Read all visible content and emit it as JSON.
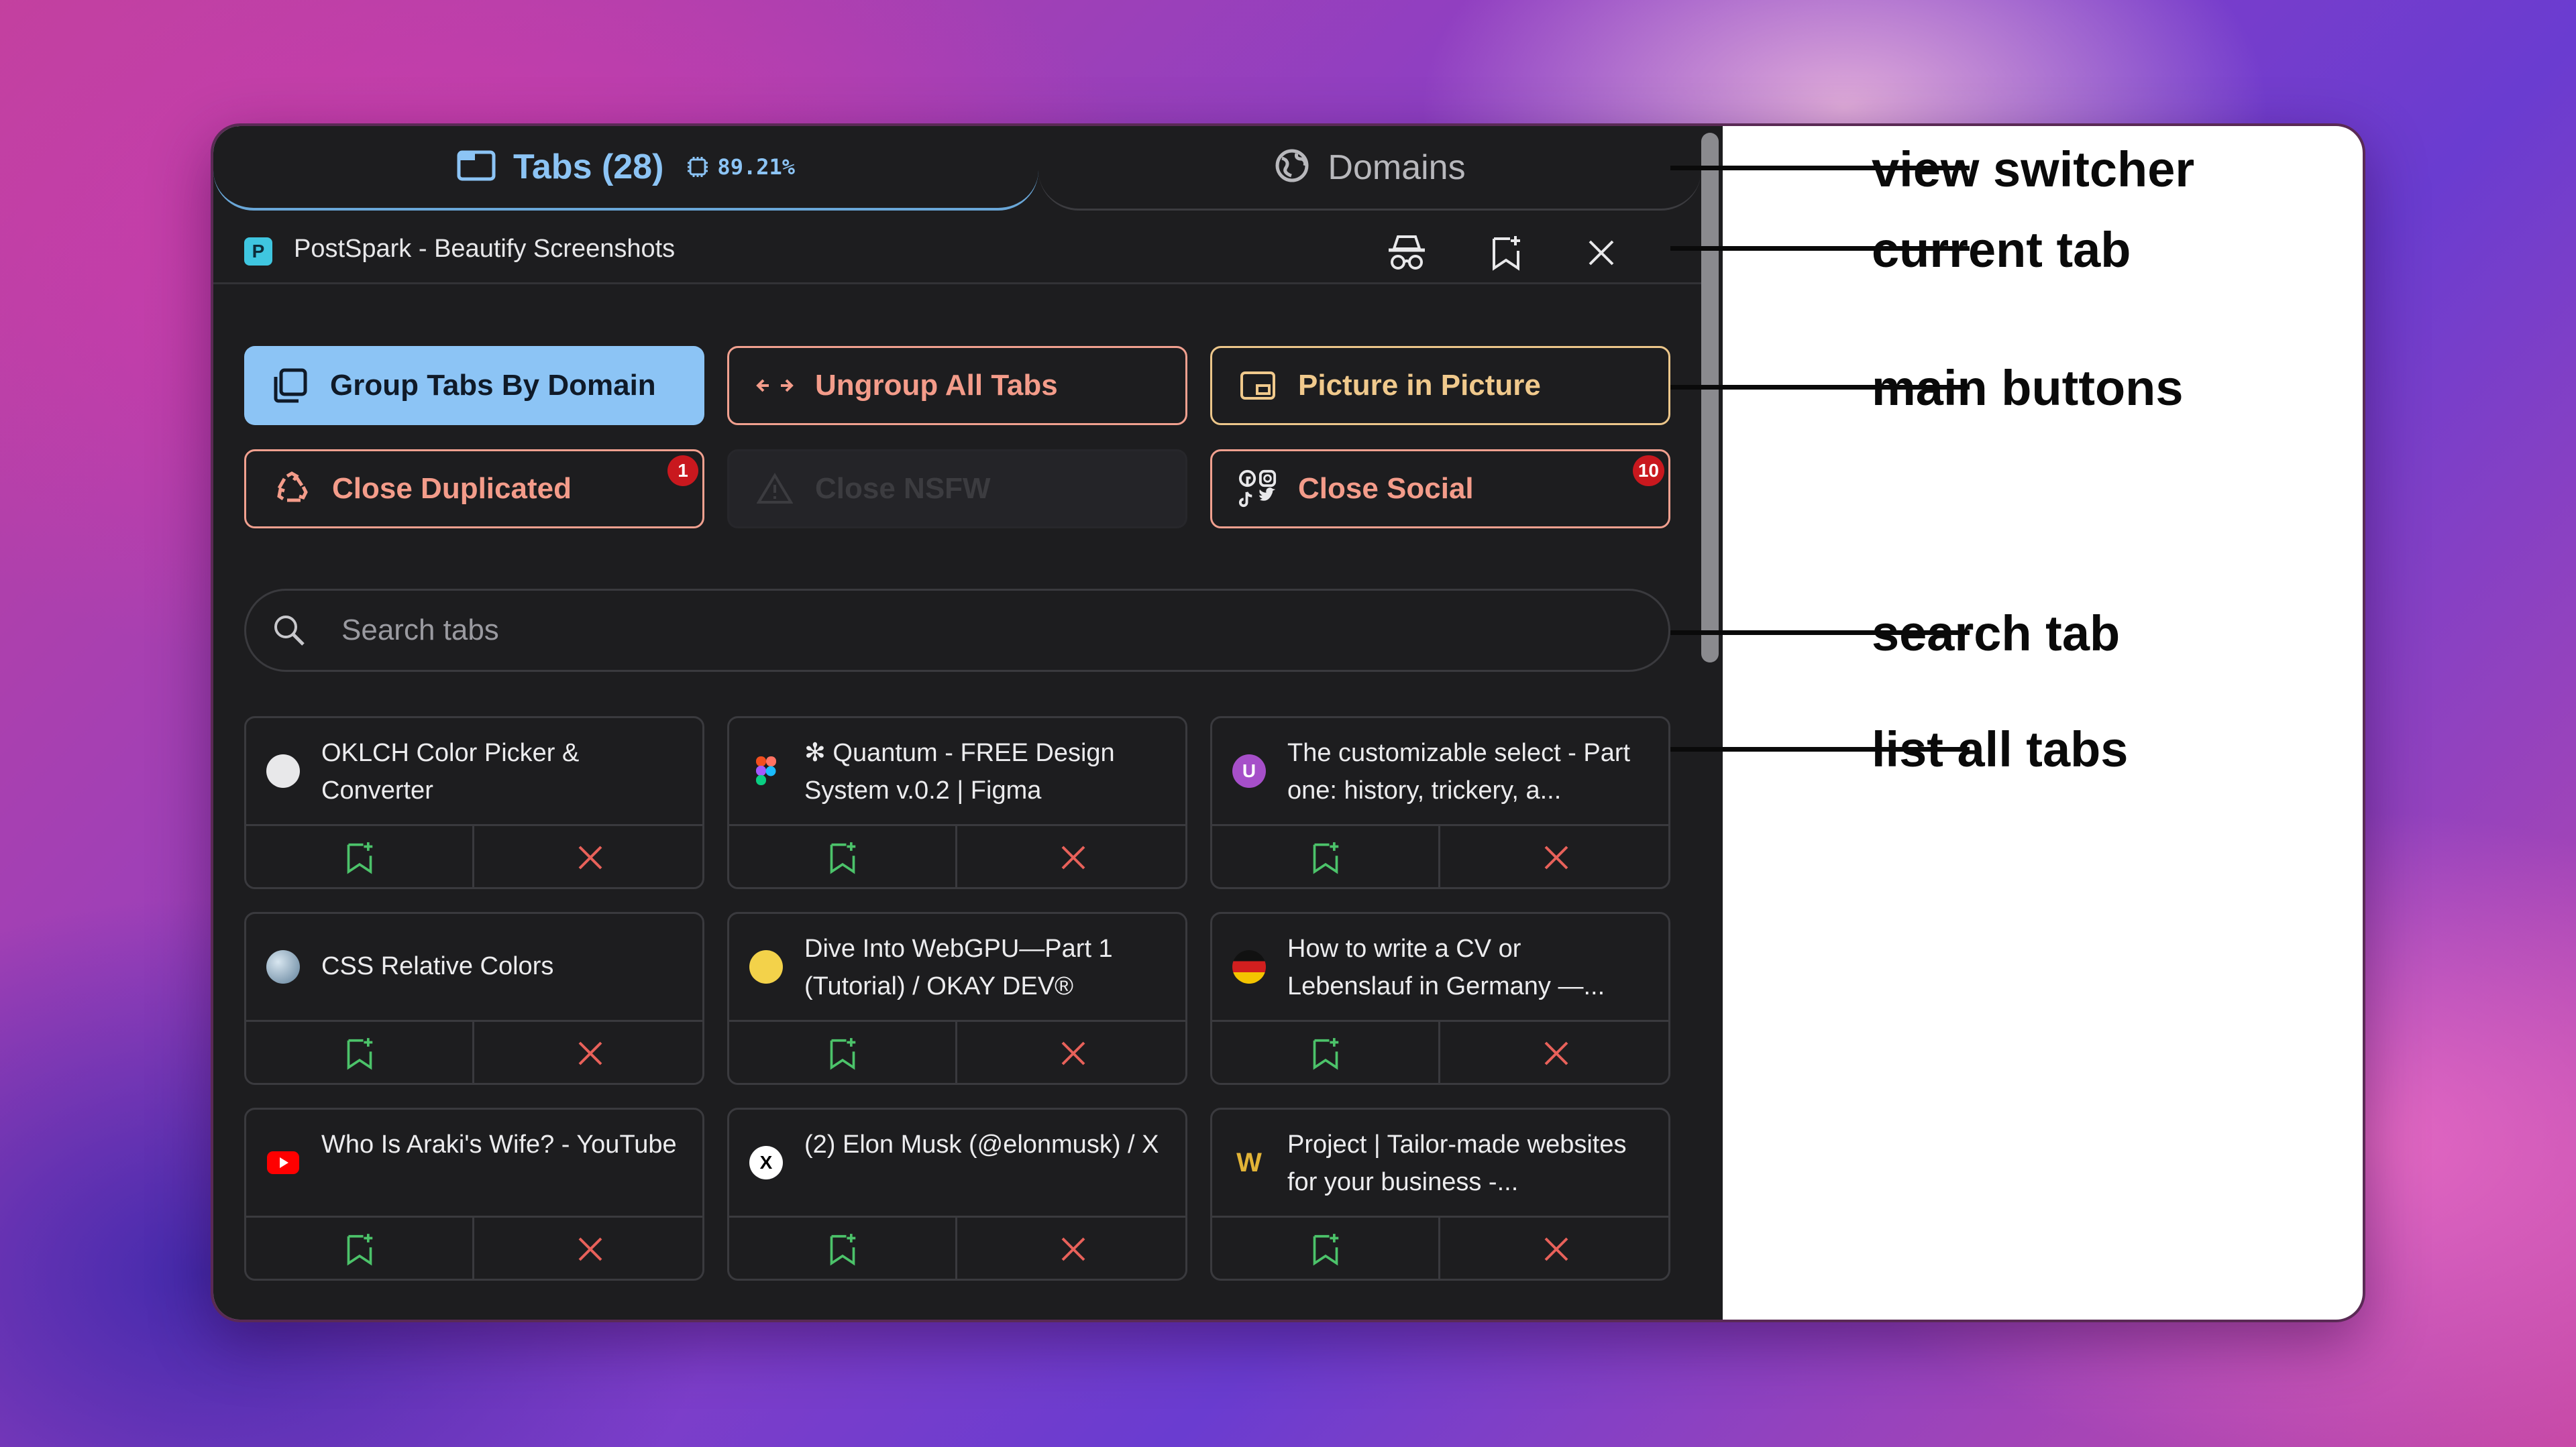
{
  "switcher": {
    "tabs_label": "Tabs (28)",
    "memory": "89.21%",
    "domains_label": "Domains"
  },
  "current_tab": {
    "favicon_letter": "P",
    "title": "PostSpark - Beautify Screenshots"
  },
  "buttons": {
    "group": "Group Tabs By Domain",
    "ungroup": "Ungroup All Tabs",
    "pip": "Picture in Picture",
    "close_duplicated": "Close Duplicated",
    "close_duplicated_badge": "1",
    "close_nsfw": "Close NSFW",
    "close_social": "Close Social",
    "close_social_badge": "10"
  },
  "search": {
    "placeholder": "Search tabs"
  },
  "tabs": [
    {
      "title": "OKLCH Color Picker & Converter",
      "favicon": "oklch-icon"
    },
    {
      "title": "✻ Quantum - FREE Design System v.0.2 | Figma",
      "favicon": "figma-icon"
    },
    {
      "title": "The customizable select - Part one: history, trickery, a...",
      "favicon": "u-icon",
      "favicon_letter": "U"
    },
    {
      "title": "CSS Relative Colors",
      "favicon": "globe-photo-icon"
    },
    {
      "title": "Dive Into WebGPU—Part 1 (Tutorial) / OKAY DEV®",
      "favicon": "smiley-icon"
    },
    {
      "title": "How to write a CV or Lebenslauf in Germany —...",
      "favicon": "german-flag-icon"
    },
    {
      "title": "Who Is Araki's Wife? - YouTube",
      "favicon": "youtube-icon"
    },
    {
      "title": "(2) Elon Musk (@elonmusk) / X",
      "favicon": "x-icon",
      "favicon_letter": "X"
    },
    {
      "title": "Project | Tailor-made websites for your business -...",
      "favicon": "w-icon",
      "favicon_letter": "W"
    }
  ],
  "annotations": {
    "view_switcher": "view switcher",
    "current_tab": "current tab",
    "main_buttons": "main buttons",
    "search_tab": "search tab",
    "list_all_tabs": "list all tabs"
  },
  "colors": {
    "panel_bg": "#1d1d1f",
    "accent_blue": "#8cc4f5",
    "coral": "#f49c8a",
    "amber": "#f0c98c",
    "badge_red": "#c9181e",
    "bookmark_green": "#4cc36a",
    "close_red": "#e8615a"
  }
}
